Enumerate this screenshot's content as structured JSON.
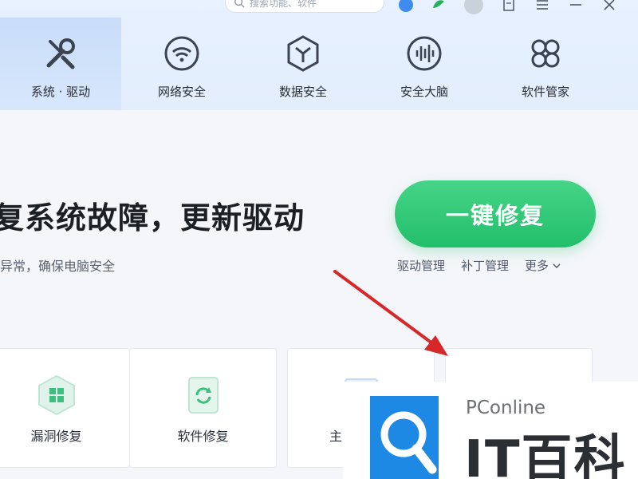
{
  "search": {
    "placeholder": "搜索功能、软件"
  },
  "nav": {
    "tabs": [
      {
        "label": "系统 · 驱动",
        "icon": "wrench-screwdriver-icon"
      },
      {
        "label": "网络安全",
        "icon": "wifi-icon"
      },
      {
        "label": "数据安全",
        "icon": "hexagon-data-icon"
      },
      {
        "label": "安全大脑",
        "icon": "voice-wave-icon"
      },
      {
        "label": "软件管家",
        "icon": "software-flower-icon"
      }
    ]
  },
  "main": {
    "headline": "复系统故障，更新驱动",
    "subline": "异常，确保电脑安全",
    "fix_button": "一键修复",
    "links": [
      "驱动管理",
      "补丁管理",
      "更多"
    ]
  },
  "cards": [
    {
      "label": "漏洞修复",
      "icon": "windows-shield-icon"
    },
    {
      "label": "软件修复",
      "icon": "refresh-doc-icon"
    },
    {
      "label": "主",
      "icon": "window-icon"
    },
    {
      "label": "",
      "icon": "panel-icon"
    }
  ],
  "watermark": {
    "brand": "PConline",
    "name": "IT百科"
  },
  "colors": {
    "accent_green": "#22bf6b",
    "tab_active": "#c9ddf9",
    "arrow_red": "#d62828",
    "brand_blue": "#1e88e5"
  }
}
